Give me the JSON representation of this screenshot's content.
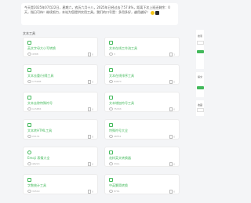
{
  "notice": {
    "text": "今天是2025年07月22日，星期六，农历六月十八，2025年已经过去了57.8%，距离下次上班还剩余：0天，指日可待！继续努力，本站为您提供实用工具。我们的口号是：多用多好，越用越好！",
    "emoji": "smile"
  },
  "section_title": "文本工具",
  "cards": [
    {
      "title": "英文字母大小写转换",
      "views": "4588",
      "likes": "0",
      "icon": "case-icon"
    },
    {
      "title": "文本在线工作流工具",
      "views": "3",
      "likes": "1",
      "icon": "workflow-icon"
    },
    {
      "title": "文本去重/分隔工具",
      "views": "175908",
      "likes": "0",
      "icon": "dedupe-icon"
    },
    {
      "title": "文本在线排序工具",
      "views": "84870",
      "likes": "0",
      "icon": "sort-icon"
    },
    {
      "title": "文本去除特殊符号",
      "views": "115855",
      "likes": "0",
      "icon": "symbol-icon"
    },
    {
      "title": "文本增加符号工具",
      "views": "75333",
      "likes": "0",
      "icon": "add-symbol-icon"
    },
    {
      "title": "文本转HTML工具",
      "views": "20131",
      "likes": "0",
      "icon": "html-icon"
    },
    {
      "title": "特殊符号大全",
      "views": "48551",
      "likes": "0",
      "icon": "special-icon"
    },
    {
      "title": "Emoji 表情大全",
      "views": "48213",
      "likes": "0",
      "icon": "emoji-icon"
    },
    {
      "title": "花样英文转换器",
      "views": "3311",
      "likes": "0",
      "icon": "font-icon"
    },
    {
      "title": "字数统计工具",
      "views": "34519",
      "likes": "0",
      "icon": "count-icon"
    },
    {
      "title": "中英繁简转换",
      "views": "8761",
      "likes": "0",
      "icon": "convert-icon"
    }
  ],
  "sidebar": {
    "label_1": "搜索",
    "label_2": "提交",
    "label_3": "收藏"
  },
  "colors": {
    "accent": "#43b95b",
    "background": "#f4f5f7"
  }
}
